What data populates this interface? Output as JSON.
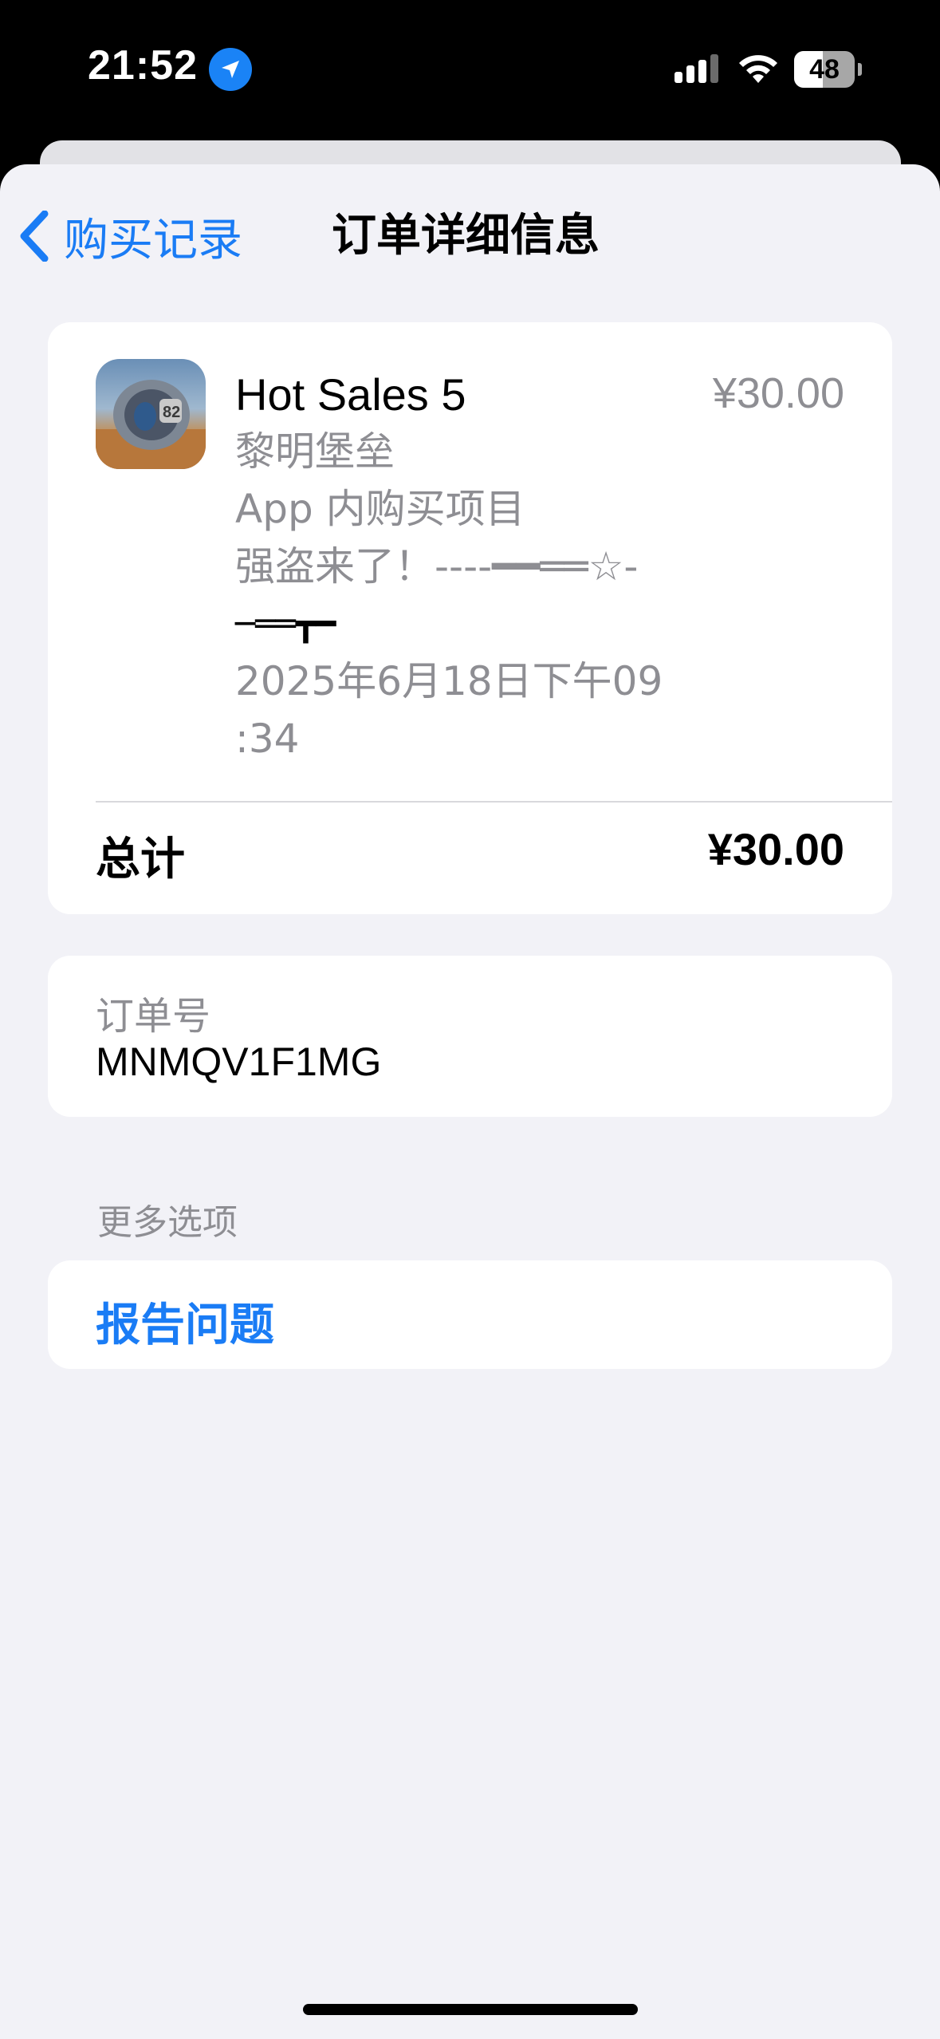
{
  "status_bar": {
    "time": "21:52",
    "battery_level": "48",
    "battery_fraction": 0.48,
    "icons": [
      "location-arrow-icon",
      "cellular-signal-icon",
      "wifi-icon",
      "battery-icon"
    ]
  },
  "nav": {
    "back_label": "购买记录",
    "title": "订单详细信息"
  },
  "purchase": {
    "app_name": "Hot Sales 5",
    "price": "¥30.00",
    "developer": "黎明堡垒",
    "type": "App 内购买项目",
    "item_name_line1": "强盗来了！----━━══☆-",
    "item_name_line2": "─══┳━",
    "date_line1": "2025年6月18日下午09",
    "date_line2": ":34",
    "total_label": "总计",
    "total_value": "¥30.00"
  },
  "order": {
    "label": "订单号",
    "value": "MNMQV1F1MG"
  },
  "more_options": {
    "header": "更多选项",
    "report_label": "报告问题"
  },
  "colors": {
    "accent": "#1a7cf5",
    "secondary_text": "#8e8e93",
    "background": "#f2f2f7",
    "card": "#ffffff"
  }
}
